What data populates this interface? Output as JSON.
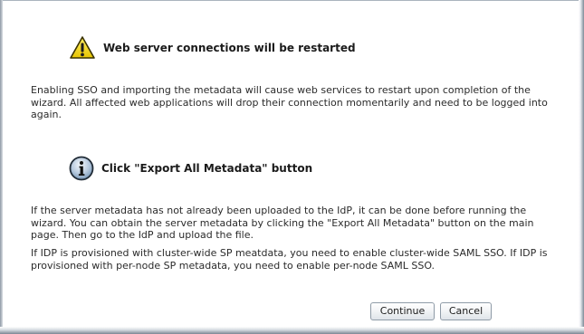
{
  "warning": {
    "icon": "warning-icon",
    "title": "Web server connections will be restarted",
    "message": "Enabling SSO and importing the metadata will cause web services to restart upon completion of the wizard. All affected web applications will drop their connection momentarily and need to be logged into again."
  },
  "info": {
    "icon": "info-icon",
    "title": "Click \"Export All Metadata\" button",
    "message": "If the server metadata has not already been uploaded to the IdP, it can be done before running the wizard. You can obtain the server metadata by clicking the \"Export All Metadata\" button on the main page. Then go to the IdP and upload the file.",
    "provisioning_note": "If IDP is provisioned with cluster-wide SP meatdata, you need to enable cluster-wide SAML SSO. If IDP is provisioned with per-node SP metadata, you need to enable per-node SAML SSO."
  },
  "actions": {
    "continue_label": "Continue",
    "cancel_label": "Cancel"
  },
  "colors": {
    "warning_yellow": "#f2d51c",
    "info_blue": "#6d8fb1",
    "button_border": "#8f9ba7"
  }
}
